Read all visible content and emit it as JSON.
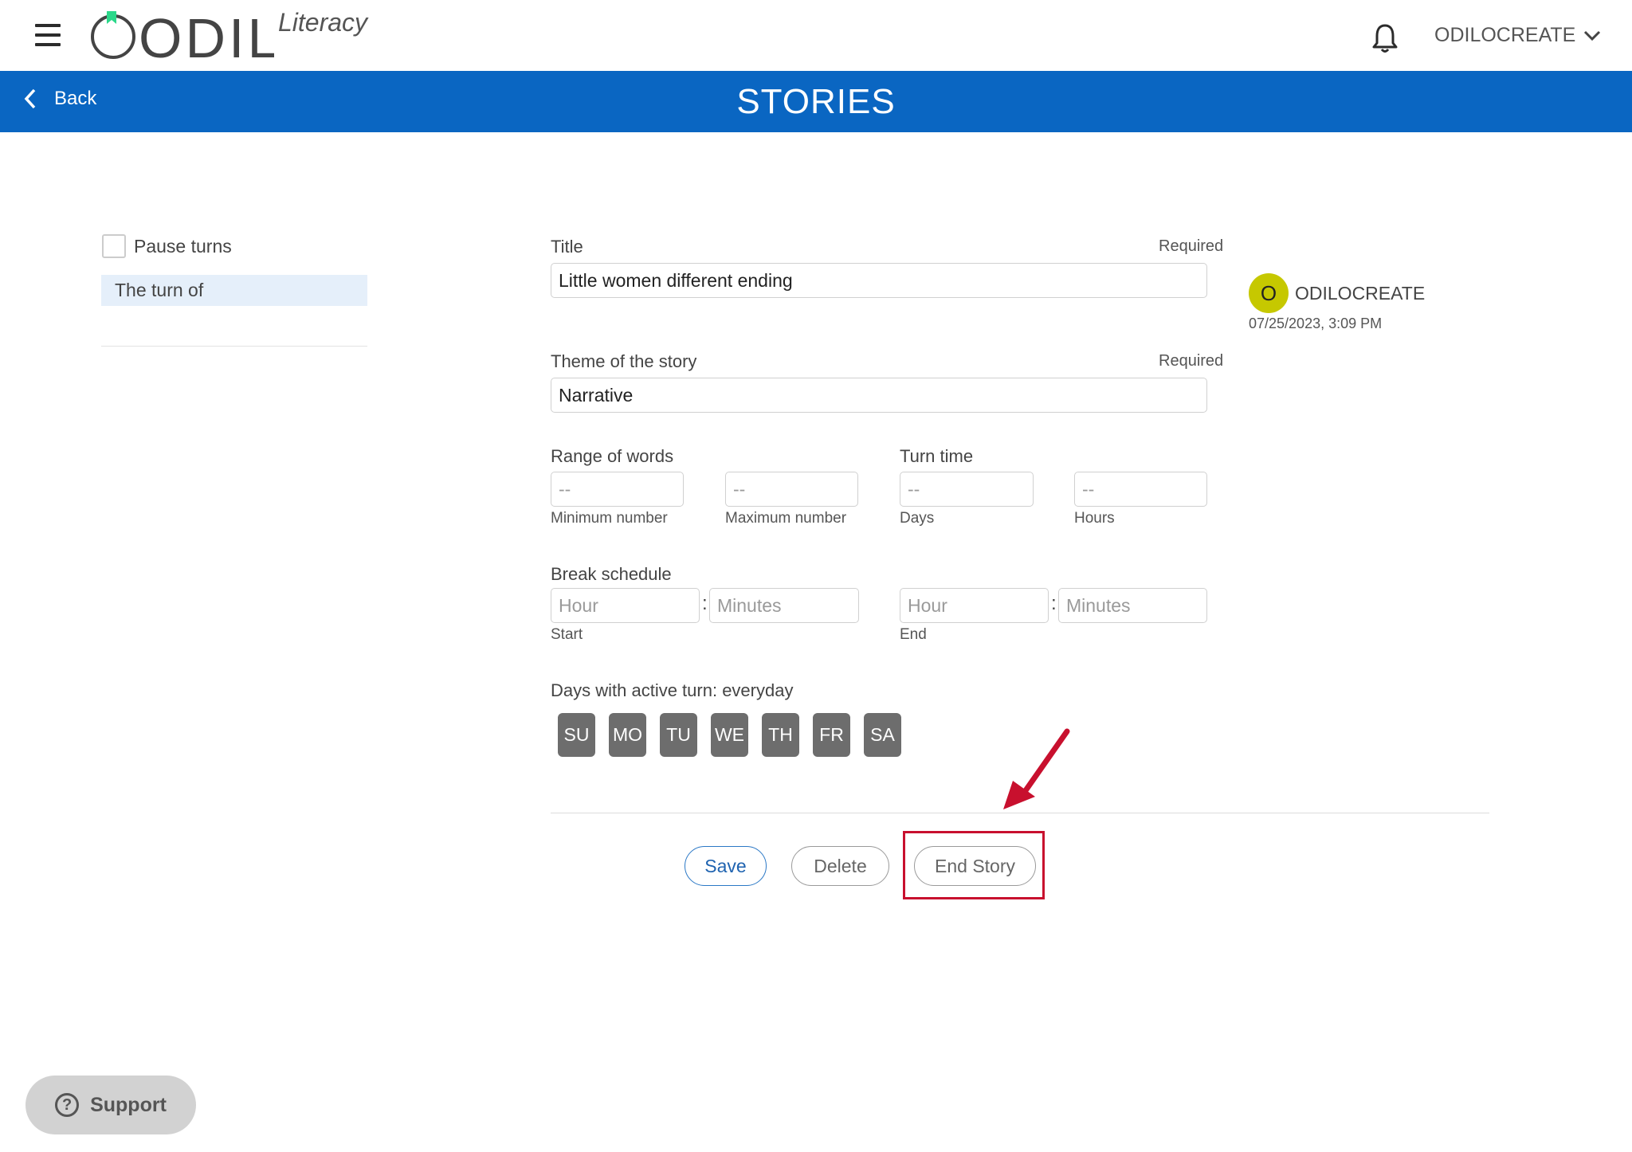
{
  "header": {
    "logo_text": "ODILO",
    "logo_sub": "Literacy",
    "user_menu_label": "ODILOCREATE",
    "icons": {
      "menu": "hamburger-menu-icon",
      "notifications": "bell-icon",
      "dropdown": "chevron-down-icon"
    }
  },
  "banner": {
    "back_label": "Back",
    "page_title": "STORIES"
  },
  "left_panel": {
    "pause_turns_label": "Pause turns",
    "turn_of_label": "The turn of"
  },
  "form": {
    "title": {
      "label": "Title",
      "required": "Required",
      "value": "Little women different ending"
    },
    "theme": {
      "label": "Theme of the story",
      "required": "Required",
      "value": "Narrative"
    },
    "range_of_words": {
      "label": "Range of words",
      "min_placeholder": "--",
      "min_sub": "Minimum number",
      "max_placeholder": "--",
      "max_sub": "Maximum number"
    },
    "turn_time": {
      "label": "Turn time",
      "days_placeholder": "--",
      "days_sub": "Days",
      "hours_placeholder": "--",
      "hours_sub": "Hours"
    },
    "break_schedule": {
      "label": "Break schedule",
      "start_hour_placeholder": "Hour",
      "start_minutes_placeholder": "Minutes",
      "start_sub": "Start",
      "end_hour_placeholder": "Hour",
      "end_minutes_placeholder": "Minutes",
      "end_sub": "End",
      "separator": ":"
    },
    "days": {
      "label": "Days with active turn: everyday",
      "items": [
        "SU",
        "MO",
        "TU",
        "WE",
        "TH",
        "FR",
        "SA"
      ]
    }
  },
  "actions": {
    "save": "Save",
    "delete": "Delete",
    "end_story": "End Story"
  },
  "author": {
    "initial": "O",
    "name": "ODILOCREATE",
    "date": "07/25/2023, 3:09 PM"
  },
  "support": {
    "label": "Support"
  },
  "colors": {
    "brand_blue": "#0a66c2",
    "highlight_red": "#c8102e",
    "avatar": "#c6c800",
    "day_chip": "#6d6d6d"
  }
}
